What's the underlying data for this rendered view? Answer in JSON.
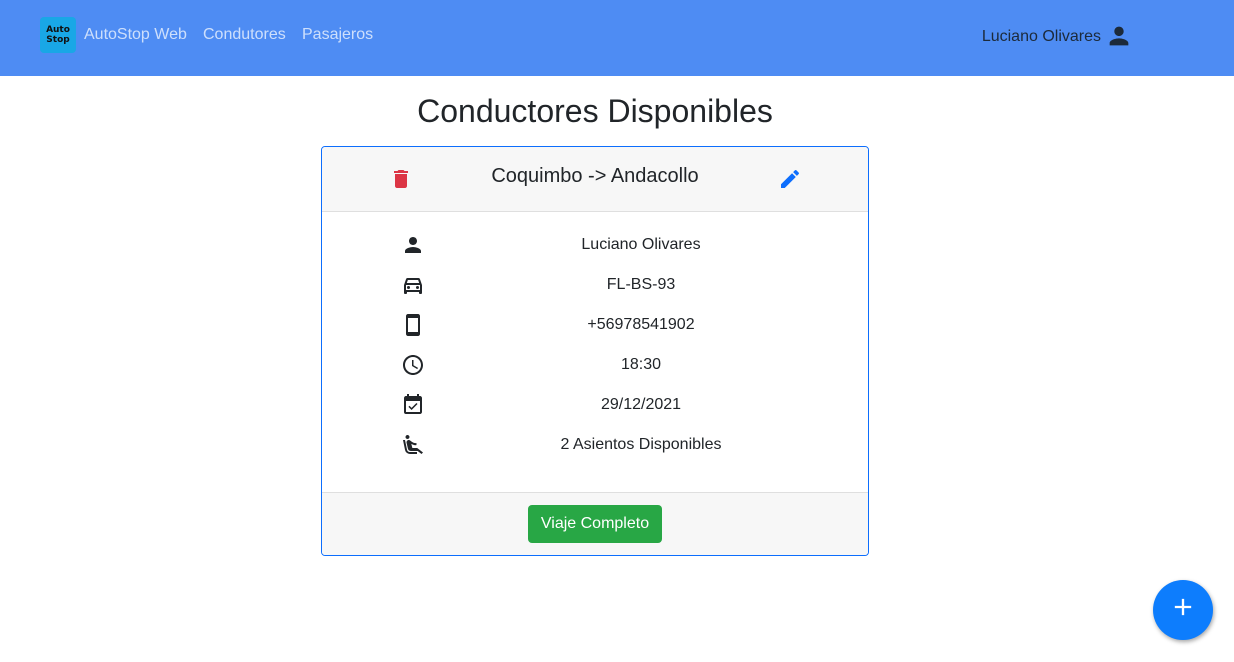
{
  "navbar": {
    "logo_line1": "Auto",
    "logo_line2": "Stop",
    "brand": "AutoStop Web",
    "links": [
      "Condutores",
      "Pasajeros"
    ],
    "user_name": "Luciano Olivares",
    "user_icon": "person-icon"
  },
  "page": {
    "title": "Conductores Disponibles"
  },
  "card": {
    "route": "Coquimbo -> Andacollo",
    "delete_icon": "trash-icon",
    "edit_icon": "pencil-icon",
    "driver": "Luciano Olivares",
    "plate": "FL-BS-93",
    "phone": "+56978541902",
    "time": "18:30",
    "date": "29/12/2021",
    "seats": "2 Asientos Disponibles",
    "footer_button": "Viaje Completo"
  },
  "fab": {
    "icon": "plus-icon"
  },
  "colors": {
    "navbar": "#4e8cf3",
    "accent": "#0d6efd",
    "danger": "#dc3545",
    "success": "#28a745",
    "fab": "#0d7dfd"
  }
}
